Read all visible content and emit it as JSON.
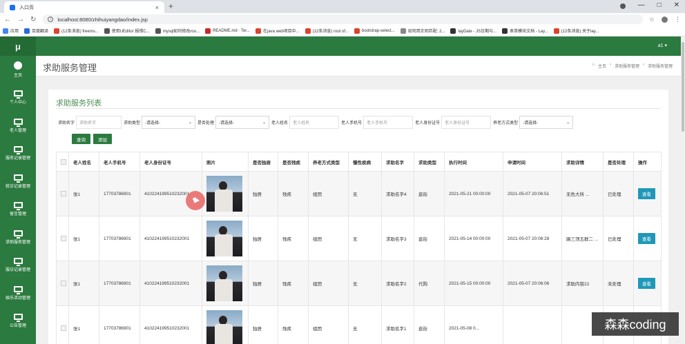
{
  "browser": {
    "tab_title": "入口页",
    "url": "localhost:8080/zhihuiyangdao/index.jsp",
    "bookmarks": [
      "应用",
      "百度翻译",
      "(12条消息) freems...",
      "使用UEditor 报错C...",
      "mysql如何修改roo...",
      "README.md · Ter...",
      "在java web项目中...",
      "(12条消息) root of...",
      "bootstrap-select...",
      "如何用正则匹配: 2...",
      "layDate - JS日期与...",
      "表单模块文档 - Lay...",
      "(12条消息) 关于lay..."
    ]
  },
  "app": {
    "logo": "μ",
    "user": "a1 ▾"
  },
  "sidebar": {
    "items": [
      {
        "label": "主页",
        "icon": "dashboard-icon"
      },
      {
        "label": "个人中心",
        "icon": "monitor-icon"
      },
      {
        "label": "老人管理",
        "icon": "monitor-icon"
      },
      {
        "label": "服务记录管理",
        "icon": "monitor-icon"
      },
      {
        "label": "就诊记录管理",
        "icon": "monitor-icon"
      },
      {
        "label": "留言管理",
        "icon": "monitor-icon"
      },
      {
        "label": "求助服务管理",
        "icon": "monitor-icon"
      },
      {
        "label": "服访记录管理",
        "icon": "monitor-icon"
      },
      {
        "label": "娱乐活动管理",
        "icon": "monitor-icon"
      },
      {
        "label": "公告管理",
        "icon": "monitor-icon"
      }
    ]
  },
  "page": {
    "title": "求助服务管理",
    "breadcrumb": [
      "主页",
      "求助服务管理",
      "求助服务管理"
    ]
  },
  "list": {
    "title": "求助服务列表",
    "filters": {
      "help_name_label": "求助名字",
      "help_name_placeholder": "求助名字",
      "help_type_label": "求助类型",
      "help_type_value": "-请选择-",
      "processed_label": "是否处理",
      "processed_value": "-请选择-",
      "elder_name_label": "老人姓名",
      "elder_name_placeholder": "老人姓名",
      "elder_phone_label": "老人手机号",
      "elder_phone_placeholder": "老人手机号",
      "elder_id_label": "老人身份证号",
      "elder_id_placeholder": "老人身份证号",
      "care_type_label": "养老方式类型",
      "care_type_value": "-请选择-"
    },
    "query_button": "查询",
    "add_button": "添加",
    "columns": [
      "老人姓名",
      "老人手机号",
      "老人身份证号",
      "照片",
      "是否独居",
      "是否残疾",
      "养老方式类型",
      "慢性疾病",
      "求助名字",
      "求助类型",
      "执行时间",
      "申请时间",
      "求助详情",
      "是否处理",
      "操作"
    ],
    "rows": [
      {
        "name": "张1",
        "phone": "17703786901",
        "id": "410224199510232001",
        "alone": "独居",
        "disabled": "残疾",
        "care": "组团",
        "chronic": "无",
        "help_name": "求助名字4",
        "help_type": "逛街",
        "exec_time": "2021-05-21 00:00:00",
        "apply_time": "2021-05-07 20:06:51",
        "detail": "无色大所 ...",
        "processed": "已处理",
        "action": "查看"
      },
      {
        "name": "张1",
        "phone": "17703786901",
        "id": "410224199510232001",
        "alone": "独居",
        "disabled": "残疾",
        "care": "组团",
        "chronic": "无",
        "help_name": "求助名字3",
        "help_type": "逛街",
        "exec_time": "2021-05-14 00:00:00",
        "apply_time": "2021-05-07 20:06:28",
        "detail": "踢三顶五群二 ...",
        "processed": "已处理",
        "action": "查看"
      },
      {
        "name": "张1",
        "phone": "17703786901",
        "id": "410224199510232001",
        "alone": "独居",
        "disabled": "残疾",
        "care": "组团",
        "chronic": "无",
        "help_name": "求助名字2",
        "help_type": "代购",
        "exec_time": "2021-05-15 00:00:00",
        "apply_time": "2021-05-07 20:06:06",
        "detail": "求助内容22",
        "processed": "未处理",
        "action": "查看"
      },
      {
        "name": "张1",
        "phone": "17703786901",
        "id": "410224199510232001",
        "alone": "独居",
        "disabled": "残疾",
        "care": "组团",
        "chronic": "无",
        "help_name": "求助名字1",
        "help_type": "逛街",
        "exec_time": "2021-05-08 0...",
        "apply_time": "",
        "detail": "",
        "processed": "",
        "action": ""
      }
    ]
  },
  "watermark": "森森coding"
}
